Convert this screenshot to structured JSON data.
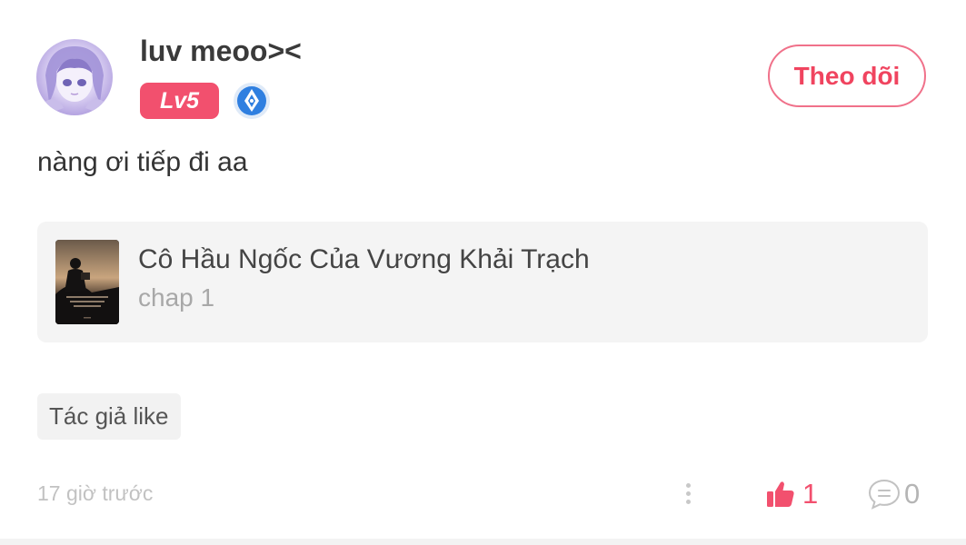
{
  "user": {
    "name": "luv meoo><",
    "level_badge": "Lv5",
    "avatar_icon": "anime-girl-avatar",
    "verified_icon": "pen-nib-badge-icon"
  },
  "follow_button": {
    "label": "Theo dõi",
    "accent_color": "#f0445f"
  },
  "comment": {
    "text": "nàng ơi tiếp đi aa"
  },
  "story_card": {
    "title": "Cô Hầu Ngốc Của Vương Khải Trạch",
    "chapter": "chap 1"
  },
  "tags": {
    "author_like": "Tác giả like"
  },
  "footer": {
    "timestamp": "17 giờ trước",
    "like_count": "1",
    "comment_count": "0",
    "like_color": "#f2506e"
  }
}
